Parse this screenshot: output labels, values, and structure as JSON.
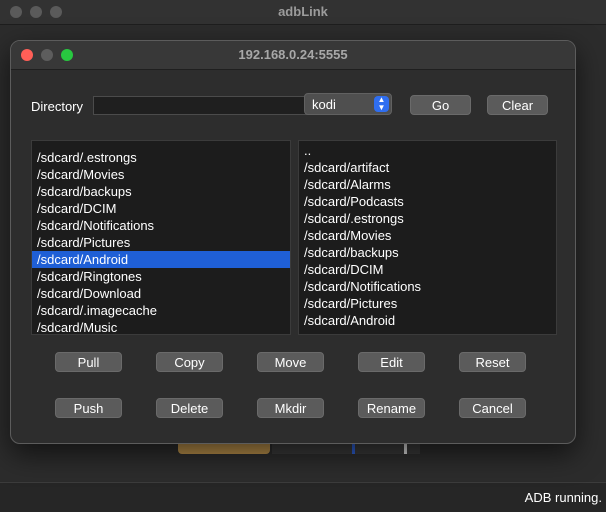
{
  "app": {
    "title": "adbLink",
    "status": "ADB running."
  },
  "dialog": {
    "title": "192.168.0.24:5555",
    "directory": {
      "label": "Directory",
      "value": ""
    },
    "device_select": {
      "value": "kodi"
    },
    "go_label": "Go",
    "clear_label": "Clear"
  },
  "left_list": {
    "items": [
      "/sdcard/.estrongs",
      "/sdcard/Movies",
      "/sdcard/backups",
      "/sdcard/DCIM",
      "/sdcard/Notifications",
      "/sdcard/Pictures",
      "/sdcard/Android",
      "/sdcard/Ringtones",
      "/sdcard/Download",
      "/sdcard/.imagecache",
      "/sdcard/Music"
    ],
    "selected_index": 6
  },
  "right_list": {
    "items": [
      "..",
      "/sdcard/artifact",
      "/sdcard/Alarms",
      "/sdcard/Podcasts",
      "/sdcard/.estrongs",
      "/sdcard/Movies",
      "/sdcard/backups",
      "/sdcard/DCIM",
      "/sdcard/Notifications",
      "/sdcard/Pictures",
      "/sdcard/Android"
    ]
  },
  "buttons": {
    "row1": [
      "Pull",
      "Copy",
      "Move",
      "Edit",
      "Reset"
    ],
    "row2": [
      "Push",
      "Delete",
      "Mkdir",
      "Rename",
      "Cancel"
    ]
  },
  "colors": {
    "selection": "#1f5fd6",
    "close": "#ff5f57",
    "zoom": "#28c840",
    "accent": "#2f6ef0"
  }
}
